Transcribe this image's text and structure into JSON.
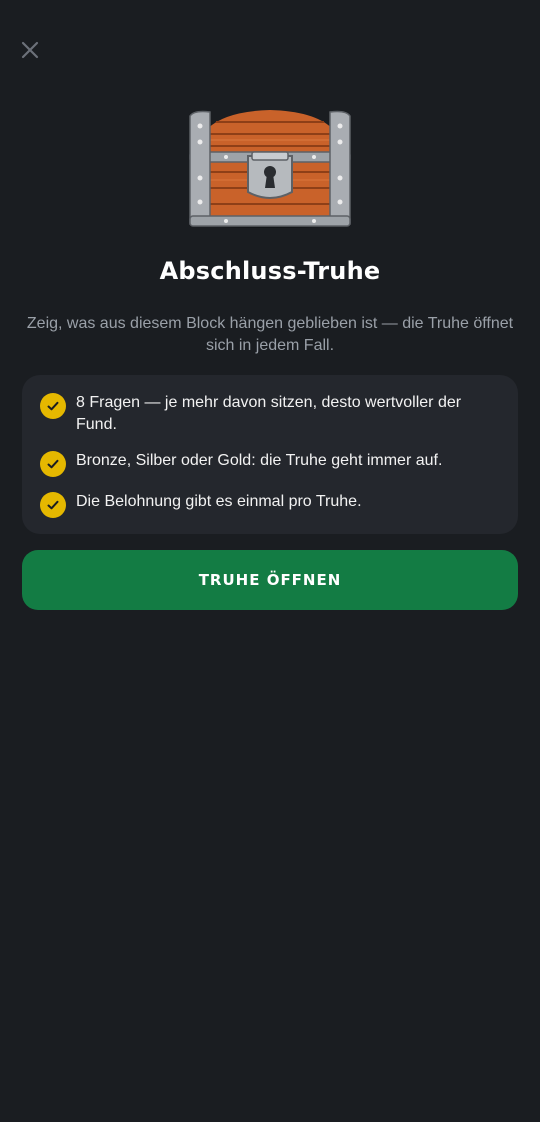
{
  "header": {
    "close_icon": "close-icon"
  },
  "hero": {
    "icon": "treasure-chest-icon",
    "title": "Abschluss-Truhe",
    "subtitle": "Zeig, was aus diesem Block hängen geblieben ist — die Truhe öffnet sich in jedem Fall."
  },
  "info_card": {
    "items": [
      {
        "icon": "check-circle-icon",
        "text": "8 Fragen — je mehr davon sitzen, desto wertvoller der Fund."
      },
      {
        "icon": "check-circle-icon",
        "text": "Bronze, Silber oder Gold: die Truhe geht immer auf."
      },
      {
        "icon": "check-circle-icon",
        "text": "Die Belohnung gibt es einmal pro Truhe."
      }
    ]
  },
  "cta": {
    "label": "TRUHE ÖFFNEN"
  },
  "colors": {
    "background": "#1a1d21",
    "card": "#24272d",
    "accent_check": "#e5b800",
    "button": "#137c44",
    "subtitle": "#9aa0a8"
  }
}
